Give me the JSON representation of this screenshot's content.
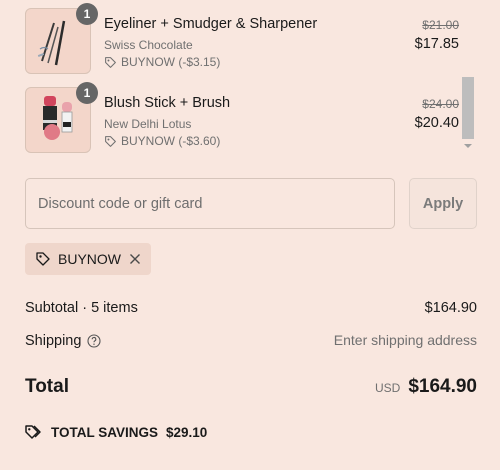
{
  "items": [
    {
      "quantity": "1",
      "name": "Eyeliner + Smudger & Sharpener",
      "variant": "Swiss Chocolate",
      "discount": "BUYNOW (-$3.15)",
      "original_price": "$21.00",
      "price": "$17.85"
    },
    {
      "quantity": "1",
      "name": "Blush Stick + Brush",
      "variant": "New Delhi Lotus",
      "discount": "BUYNOW (-$3.60)",
      "original_price": "$24.00",
      "price": "$20.40"
    }
  ],
  "discount": {
    "placeholder": "Discount code or gift card",
    "value": "",
    "apply_label": "Apply",
    "applied_code": "BUYNOW"
  },
  "summary": {
    "subtotal_label": "Subtotal · 5 items",
    "subtotal_value": "$164.90",
    "shipping_label": "Shipping",
    "shipping_value": "Enter shipping address",
    "total_label": "Total",
    "currency": "USD",
    "total_value": "$164.90",
    "savings_label": "TOTAL SAVINGS",
    "savings_value": "$29.10"
  },
  "icons": {
    "tag": "tag-icon",
    "remove": "close-icon",
    "help": "help-circle-icon",
    "savings": "double-tag-icon"
  },
  "colors": {
    "background": "#f9e7df",
    "badge": "#666666",
    "muted_text": "#707070",
    "chip": "#efd6cb"
  }
}
